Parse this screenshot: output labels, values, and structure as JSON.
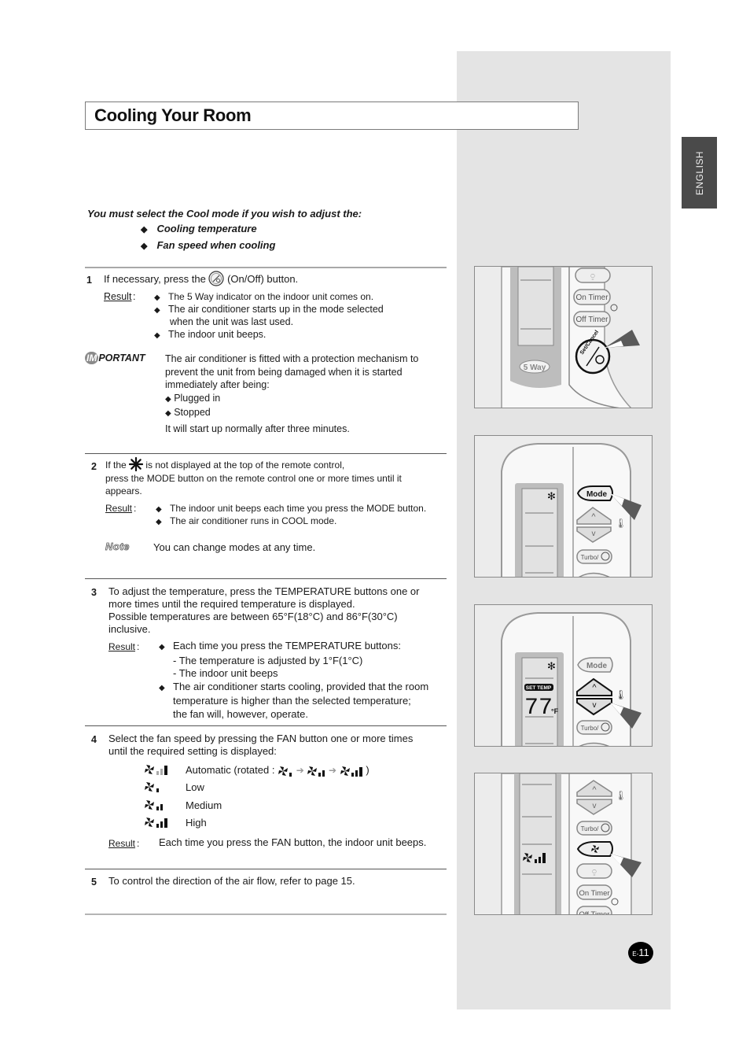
{
  "page": {
    "title": "Cooling Your Room",
    "language_tab": "ENGLISH",
    "page_number_prefix": "E-",
    "page_number": "11"
  },
  "intro": {
    "lead": "You must select the Cool mode if you wish to adjust the:",
    "items": [
      "Cooling temperature",
      "Fan speed when cooling"
    ]
  },
  "steps": [
    {
      "number": "1",
      "text_before_icon": "If necessary, press the",
      "icon": "on-off-button-icon",
      "text_after_icon": "(On/Off) button.",
      "result_label": "Result",
      "results": [
        "The 5 Way indicator on the indoor unit comes on.",
        "The air conditioner starts up in the mode selected",
        "when the unit was last used.",
        "The indoor unit beeps."
      ],
      "important": {
        "label_badge": "IM",
        "label_rest": "PORTANT",
        "lines": [
          "The air conditioner is fitted with a protection mechanism to",
          "prevent the unit from being damaged when it is started",
          "immediately after being:"
        ],
        "bullets": [
          "Plugged in",
          "Stopped"
        ],
        "footer": "It will start up normally after three minutes."
      }
    },
    {
      "number": "2",
      "text_before_icon": "If the",
      "icon": "snowflake-icon",
      "text_after_icon": "is not displayed at the top of the remote control,",
      "lines": [
        "press the MODE button on the remote control one or more times until it",
        "appears."
      ],
      "result_label": "Result",
      "results": [
        "The indoor unit beeps each time you press the MODE button.",
        "The air conditioner runs in COOL mode."
      ],
      "note_label": "Note",
      "note_text": "You can change modes at any time."
    },
    {
      "number": "3",
      "lines": [
        "To adjust the temperature, press the TEMPERATURE buttons one or",
        "more times until the required temperature is displayed.",
        "Possible temperatures are between 65°F(18°C) and 86°F(30°C)",
        "inclusive."
      ],
      "result_label": "Result",
      "results": [
        "Each time you press the TEMPERATURE buttons:",
        "- The temperature is adjusted by 1°F(1°C)",
        "- The indoor unit beeps",
        "The air conditioner starts cooling, provided that the room",
        "temperature is higher than the selected temperature;",
        "the fan will, however, operate."
      ]
    },
    {
      "number": "4",
      "lines": [
        "Select the fan speed by pressing the FAN button one or more times",
        "until the required setting is displayed:"
      ],
      "fan_speeds": [
        {
          "icon": "fan-auto-icon",
          "label": "Automatic (rotated :",
          "label_end": ")"
        },
        {
          "icon": "fan-low-icon",
          "label": "Low"
        },
        {
          "icon": "fan-medium-icon",
          "label": "Medium"
        },
        {
          "icon": "fan-high-icon",
          "label": "High"
        }
      ],
      "result_label": "Result",
      "result_text": "Each time you press the FAN button, the indoor unit beeps."
    },
    {
      "number": "5",
      "text": "To control the direction of the air flow, refer to page 15."
    }
  ],
  "remotes": [
    {
      "buttons": [
        "On Timer",
        "Off Timer"
      ],
      "power_button_label": "Set/Cancel",
      "indicator": "5 Way",
      "highlighted": "on-off-button"
    },
    {
      "buttons": [
        "Mode",
        "Turbo/"
      ],
      "highlighted": "mode-button",
      "display_icon": "snowflake"
    },
    {
      "buttons": [
        "Mode",
        "Turbo/"
      ],
      "highlighted": "temperature-down-button",
      "display_icon": "snowflake",
      "display_label": "SET TEMP",
      "display_value": "77",
      "display_unit": "°F"
    },
    {
      "buttons": [
        "Turbo/",
        "On Timer",
        "Off Timer"
      ],
      "highlighted": "fan-button",
      "display_icon": "fan-high"
    }
  ]
}
